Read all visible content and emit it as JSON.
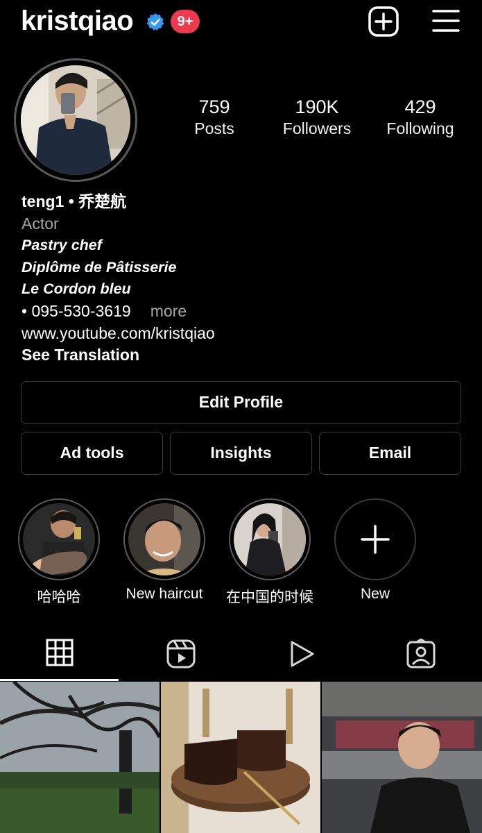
{
  "header": {
    "username": "kristqiao",
    "notification_badge": "9+",
    "icons": [
      "verified-badge-icon",
      "new-post-plus-icon",
      "hamburger-menu-icon"
    ]
  },
  "stats": [
    {
      "value": "759",
      "label": "Posts"
    },
    {
      "value": "190K",
      "label": "Followers"
    },
    {
      "value": "429",
      "label": "Following"
    }
  ],
  "bio": {
    "name": "teng1 • 乔楚航",
    "category": "Actor",
    "line1": "Pastry chef",
    "line2": "Diplôme de Pâtisserie",
    "line3": "Le Cordon bleu",
    "phone": "• 095-530-3619",
    "more": "more",
    "link": "www.youtube.com/kristqiao",
    "translation": "See Translation"
  },
  "buttons": {
    "edit_profile": "Edit Profile",
    "ad_tools": "Ad tools",
    "insights": "Insights",
    "email": "Email"
  },
  "highlights": [
    {
      "label": "哈哈哈"
    },
    {
      "label": "New haircut"
    },
    {
      "label": "在中国的时候"
    },
    {
      "label": "New"
    }
  ],
  "tabs": [
    "grid-icon",
    "reels-icon",
    "video-play-icon",
    "tagged-user-icon"
  ],
  "colors": {
    "background": "#000000",
    "badge": "#ee3a4e",
    "verified": "#3897f0",
    "muted_text": "#a8a8a8",
    "border": "#3c3c3c"
  }
}
